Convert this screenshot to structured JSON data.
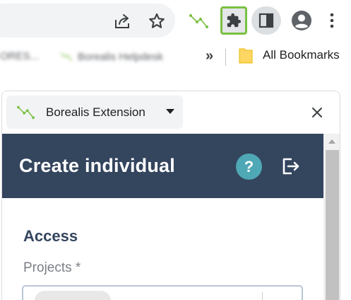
{
  "toolbar": {
    "share_icon": "share-icon",
    "bookmark_star_icon": "star-icon",
    "extension_icon": "borealis-icon",
    "extensions_button_icon": "puzzle-icon",
    "side_panel_icon": "side-panel-icon",
    "profile_icon": "account-circle-icon",
    "menu_icon": "more-vert-icon",
    "highlight_color": "#7ac142"
  },
  "bookmarks_bar": {
    "items": [
      "ORES...",
      "Borealis Helpdesk"
    ],
    "overflow_symbol": "»",
    "all_bookmarks_label": "All Bookmarks"
  },
  "popup": {
    "extension_name": "Borealis Extension",
    "close_icon": "close-icon",
    "header": {
      "title": "Create individual",
      "help_symbol": "?",
      "background_color": "#34455e",
      "help_color": "#4fa8b5"
    },
    "form": {
      "section_title": "Access",
      "projects_label": "Projects *"
    }
  }
}
